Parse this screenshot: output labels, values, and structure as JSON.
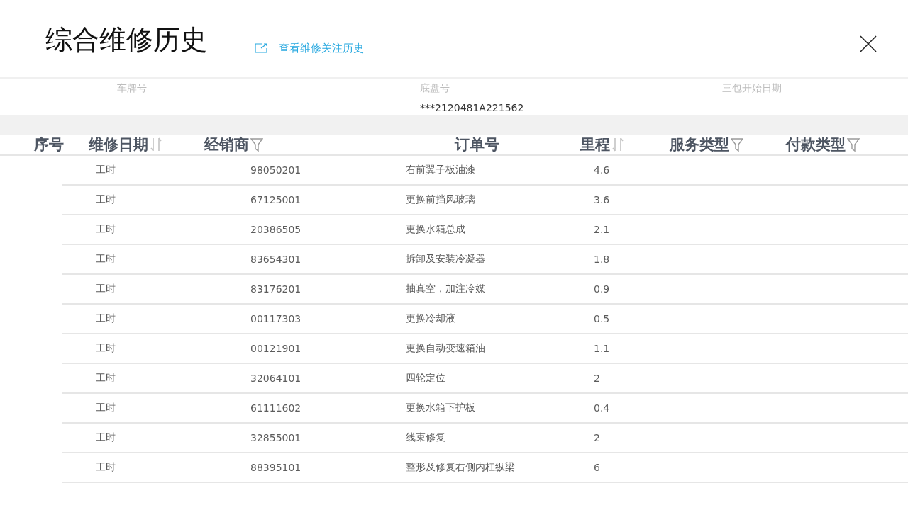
{
  "title": "综合维修历史",
  "link": {
    "label": "查看维修关注历史"
  },
  "info": [
    {
      "label": "车牌号"
    },
    {
      "label": "底盘号",
      "value": "***2120481A221562"
    },
    {
      "label": "三包开始日期"
    }
  ],
  "header": {
    "columns": [
      {
        "label": "序号",
        "kind": "plain"
      },
      {
        "label": "维修日期",
        "kind": "sort"
      },
      {
        "label": "经销商",
        "kind": "filter"
      },
      {
        "label": "订单号",
        "kind": "plain"
      },
      {
        "label": "里程",
        "kind": "sort"
      },
      {
        "label": "服务类型",
        "kind": "filter"
      },
      {
        "label": "付款类型",
        "kind": "filter"
      }
    ]
  },
  "records": {
    "items": [
      [
        "工时",
        "98050201",
        "右前翼子板油漆",
        "4.6"
      ],
      [
        "工时",
        "67125001",
        "更换前挡风玻璃",
        "3.6"
      ],
      [
        "工时",
        "20386505",
        "更换水箱总成",
        "2.1"
      ],
      [
        "工时",
        "83654301",
        "拆卸及安装冷凝器",
        "1.8"
      ],
      [
        "工时",
        "83176201",
        "抽真空，加注冷媒",
        "0.9"
      ],
      [
        "工时",
        "00117303",
        "更换冷却液",
        "0.5"
      ],
      [
        "工时",
        "00121901",
        "更换自动变速箱油",
        "1.1"
      ],
      [
        "工时",
        "32064101",
        "四轮定位",
        "2"
      ],
      [
        "工时",
        "61111602",
        "更换水箱下护板",
        "0.4"
      ],
      [
        "工时",
        "32855001",
        "线束修复",
        "2"
      ],
      [
        "工时",
        "88395101",
        "整形及修复右侧内杠纵梁",
        "6"
      ]
    ]
  }
}
